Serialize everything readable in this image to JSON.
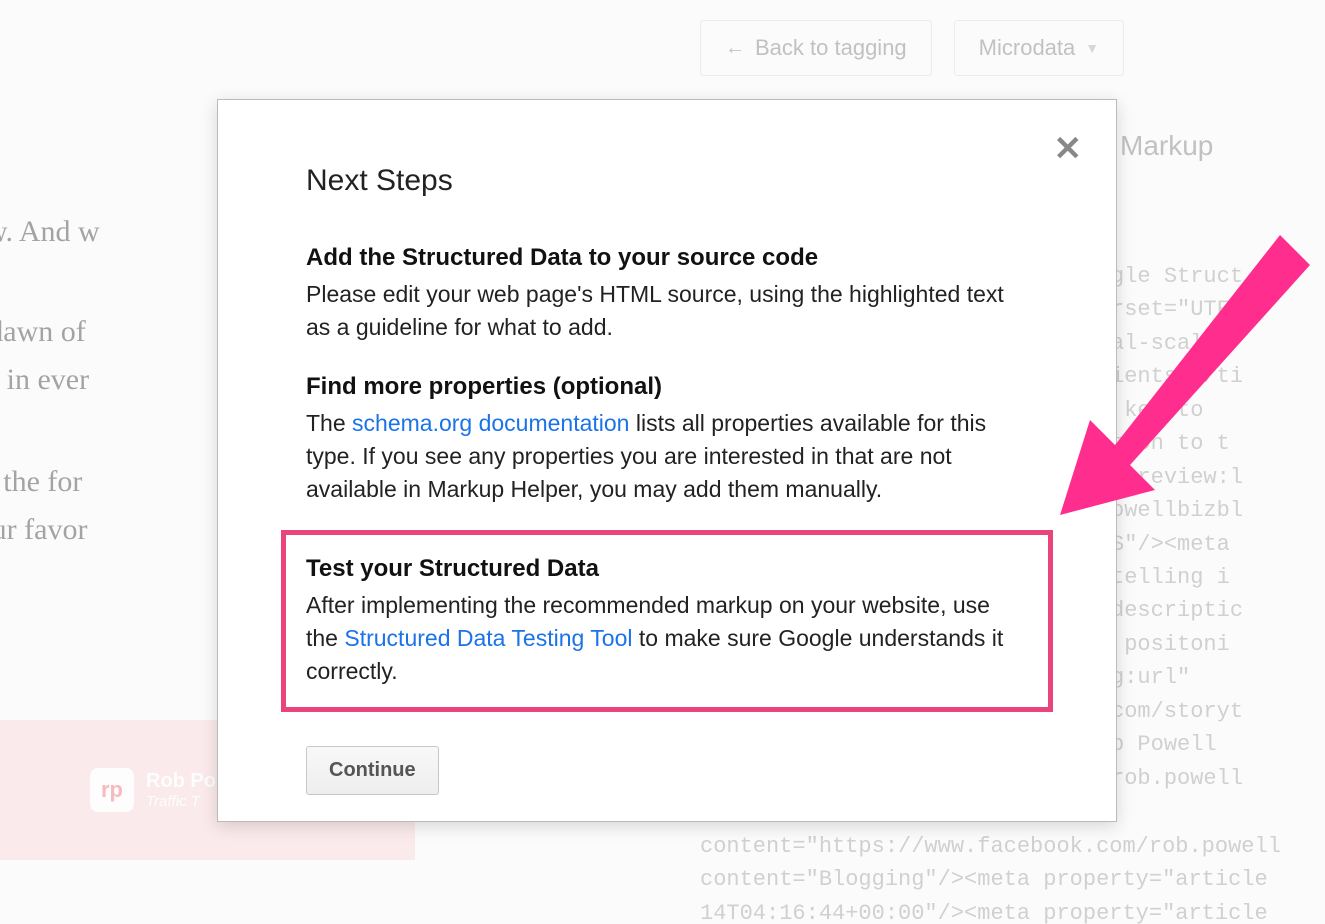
{
  "header": {
    "back_label": "Back to tagging",
    "dropdown_label": "Microdata"
  },
  "right_label": "Markup",
  "bg": {
    "line1": "ght now. And w",
    "line2": "ce the dawn of",
    "line3": "se deep in ever",
    "line4": "ay take the for",
    "line5": "ns of our favor",
    "rp_name": "Rob Po",
    "rp_sub": "Traffic T"
  },
  "code_bg": "y Google Struct\na charset=\"UTF-\ninitial-scale=\nngredients)</ti\ns the key to\n solution to t\nimage-preview:l\n/robpowellbizbl\n\"en_US\"/><meta\nStorytelling i\n=\"og:descriptic\ns and positoni\nty=\"og:url\"\nblog.com/storyt\nt=\"Rob Powell\n.com/rob.powell",
  "code_bg2": "content=\"https://www.facebook.com/rob.powell\ncontent=\"Blogging\"/><meta property=\"article\n14T04:16:44+00:00\"/><meta property=\"article",
  "dialog": {
    "title": "Next Steps",
    "close_aria": "Close",
    "section1": {
      "heading": "Add the Structured Data to your source code",
      "body": "Please edit your web page's HTML source, using the highlighted text as a guideline for what to add."
    },
    "section2": {
      "heading": "Find more properties (optional)",
      "body_pre": "The ",
      "link": "schema.org documentation",
      "body_post": " lists all properties available for this type. If you see any properties you are interested in that are not available in Markup Helper, you may add them manually."
    },
    "section3": {
      "heading": "Test your Structured Data",
      "body_pre": "After implementing the recommended markup on your website, use the ",
      "link": "Structured Data Testing Tool",
      "body_post": " to make sure Google understands it correctly."
    },
    "continue_label": "Continue"
  }
}
